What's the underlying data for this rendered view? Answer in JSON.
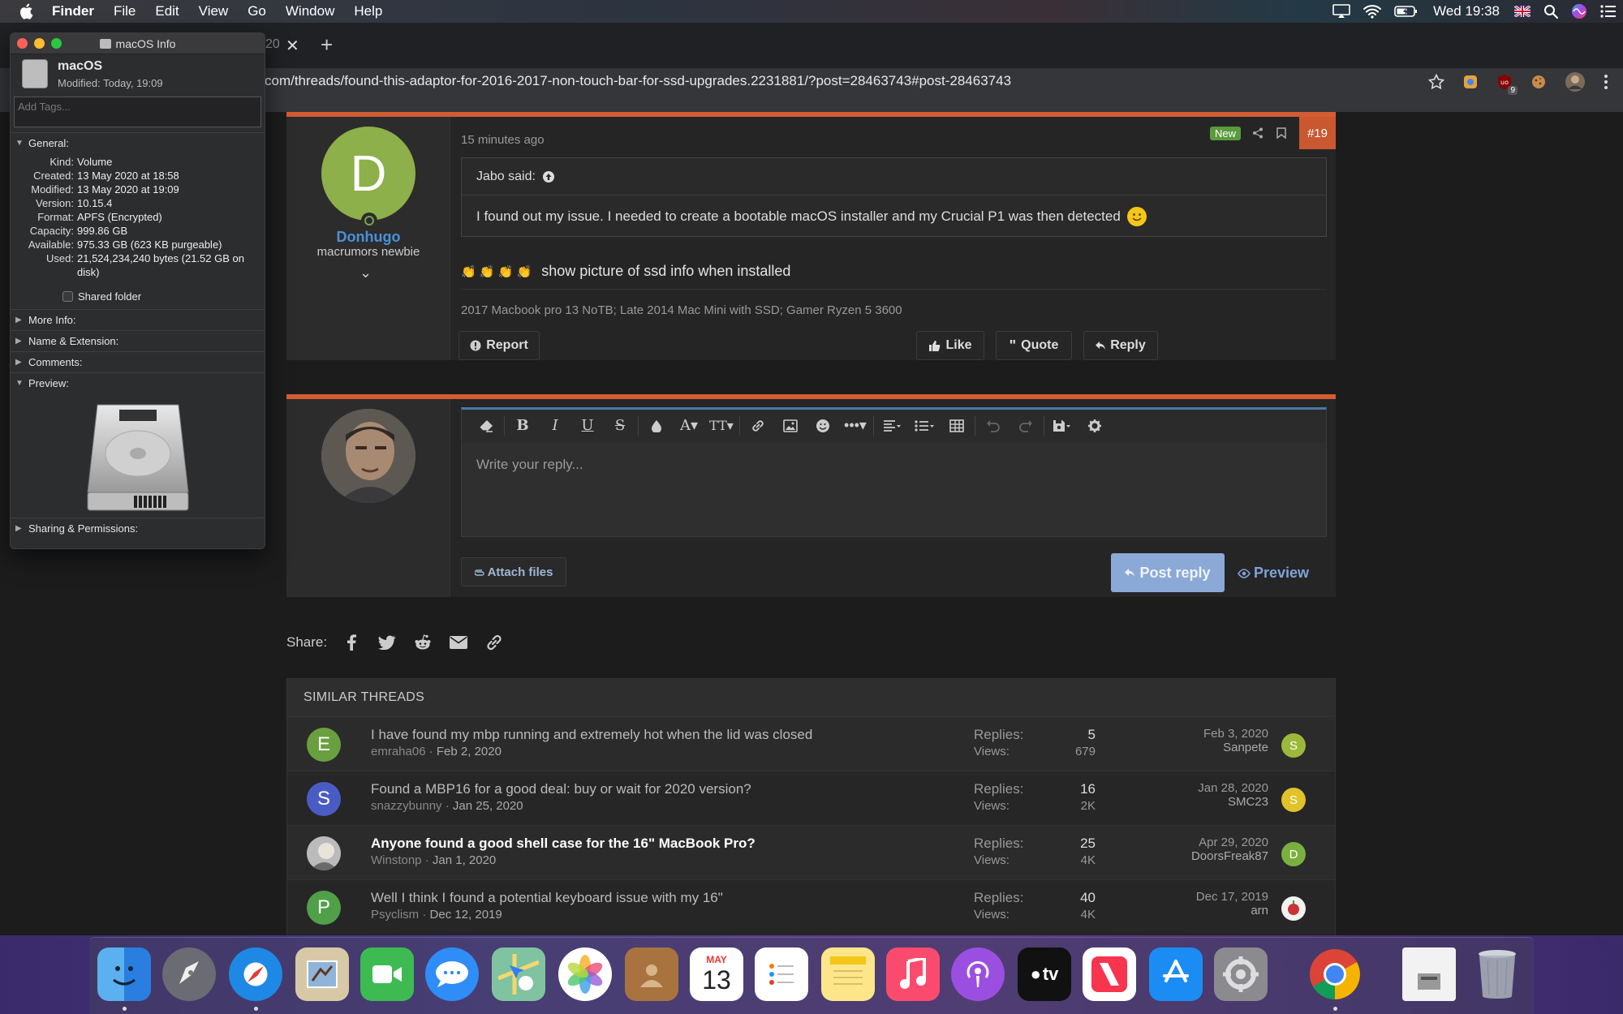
{
  "menubar": {
    "app": "Finder",
    "items": [
      "File",
      "Edit",
      "View",
      "Go",
      "Window",
      "Help"
    ],
    "clock": "Wed 19:38"
  },
  "browser": {
    "tab_fragment": "20",
    "url": "com/threads/found-this-adaptor-for-2016-2017-non-touch-bar-for-ssd-upgrades.2231881/?post=28463743#post-28463743",
    "extension_badge": "9"
  },
  "post": {
    "avatar_letter": "D",
    "username": "Donhugo",
    "user_title": "macrumors newbie",
    "time": "15 minutes ago",
    "badge": "New",
    "number": "#19",
    "quote_author": "Jabo said:",
    "quote_text": "I found out my issue. I needed to create a bootable macOS installer and my Crucial P1 was then detected",
    "message": "show picture of ssd info when installed",
    "signature": "2017 Macbook pro 13 NoTB; Late 2014 Mac Mini with SSD; Gamer Ryzen 5 3600",
    "report": "Report",
    "like": "Like",
    "quote": "Quote",
    "reply": "Reply"
  },
  "reply_editor": {
    "placeholder": "Write your reply...",
    "attach": "Attach files",
    "post_reply": "Post reply",
    "preview": "Preview"
  },
  "share": {
    "label": "Share:"
  },
  "similar": {
    "heading": "SIMILAR THREADS",
    "replies_label": "Replies:",
    "views_label": "Views:",
    "threads": [
      {
        "avatar": "E",
        "avatar_color": "#6a9f3f",
        "title": "I have found my mbp running and extremely hot when the lid was closed",
        "author": "emraha06",
        "date": "Feb 2, 2020",
        "replies": "5",
        "views": "679",
        "last_date": "Feb 3, 2020",
        "last_user": "Sanpete",
        "last_avatar": "S",
        "last_color": "#9cb83a",
        "bold": false
      },
      {
        "avatar": "S",
        "avatar_color": "#4a5cc4",
        "title": "Found a MBP16 for a good deal: buy or wait for 2020 version?",
        "author": "snazzybunny",
        "date": "Jan 25, 2020",
        "replies": "16",
        "views": "2K",
        "last_date": "Jan 28, 2020",
        "last_user": "SMC23",
        "last_avatar": "S",
        "last_color": "#e0c22a",
        "bold": false
      },
      {
        "avatar": "",
        "avatar_color": "#888888",
        "title": "Anyone found a good shell case for the 16\" MacBook Pro?",
        "author": "Winstonp",
        "date": "Jan 1, 2020",
        "replies": "25",
        "views": "4K",
        "last_date": "Apr 29, 2020",
        "last_user": "DoorsFreak87",
        "last_avatar": "D",
        "last_color": "#7ab040",
        "bold": true
      },
      {
        "avatar": "P",
        "avatar_color": "#4fa048",
        "title": "Well I think I found a potential keyboard issue with my 16\"",
        "author": "Psyclism",
        "date": "Dec 12, 2019",
        "replies": "40",
        "views": "4K",
        "last_date": "Dec 17, 2019",
        "last_user": "arn",
        "last_avatar": "",
        "last_color": "#eeeeee",
        "bold": false
      }
    ]
  },
  "finder_info": {
    "window_title": "macOS Info",
    "name": "macOS",
    "modified": "Modified: Today, 19:09",
    "tags_placeholder": "Add Tags...",
    "general_label": "General:",
    "fields": [
      {
        "k": "Kind:",
        "v": "Volume"
      },
      {
        "k": "Created:",
        "v": "13 May 2020 at 18:58"
      },
      {
        "k": "Modified:",
        "v": "13 May 2020 at 19:09"
      },
      {
        "k": "Version:",
        "v": "10.15.4"
      },
      {
        "k": "Format:",
        "v": "APFS (Encrypted)"
      },
      {
        "k": "Capacity:",
        "v": "999.86 GB"
      },
      {
        "k": "Available:",
        "v": "975.33 GB (623 KB purgeable)"
      },
      {
        "k": "Used:",
        "v": "21,524,234,240 bytes (21.52 GB on disk)"
      }
    ],
    "shared_folder": "Shared folder",
    "sections": [
      "More Info:",
      "Name & Extension:",
      "Comments:"
    ],
    "preview_label": "Preview:",
    "sharing_label": "Sharing & Permissions:"
  },
  "dock": {
    "calendar_month": "MAY",
    "calendar_day": "13",
    "tv_label": "tv"
  }
}
